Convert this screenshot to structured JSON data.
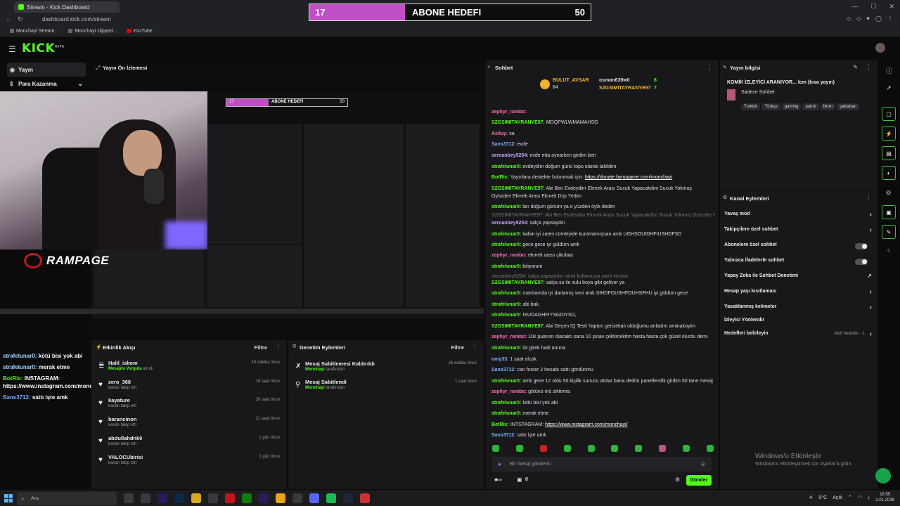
{
  "browser": {
    "tab_title": "Stream - Kick Dashboard",
    "url": "dashboard.kick.com/stream",
    "bookmarks": [
      "Monchayi Stream...",
      "Monchayi clipped...",
      "YouTube"
    ]
  },
  "sub_goal_overlay": {
    "current": "17",
    "label": "ABONE HEDEFI",
    "target": "50",
    "progress": 0.34
  },
  "brand": {
    "logo": "KICK",
    "beta": "BETA",
    "accent": "#53fc18"
  },
  "sidebar": {
    "items": [
      {
        "label": "Yayın",
        "icon": "broadcast-icon"
      },
      {
        "label": "Para Kazanma",
        "icon": "money-icon"
      }
    ]
  },
  "preview": {
    "title": "Yayın Ön İzlemesi",
    "watermark": "RAMPAGE",
    "mini_chat": [
      {
        "user": "strafelunar0:",
        "text": "kötü bisi yok abi"
      },
      {
        "user": "strafelunar0:",
        "text": "merak etme"
      },
      {
        "user": "BotRix:",
        "text": "INSTAGRAM:"
      },
      {
        "user": "",
        "text": "https://www.instagram.com/monchayi/"
      },
      {
        "user": "Sans3712:",
        "text": "sattı işte amk"
      }
    ]
  },
  "activity": {
    "title": "Etkinlik Akışı",
    "filter": "Filtre",
    "items": [
      {
        "name": "Halil_iskom",
        "action": "Mesajını Vurgula",
        "action_suffix": "alındı",
        "time": "15 dakika önce"
      },
      {
        "name": "zero_368",
        "action": "kanalı takip etti",
        "time": "19 saat önce"
      },
      {
        "name": "kayature",
        "action": "kanalı takip etti",
        "time": "20 saat önce"
      },
      {
        "name": "barancinon",
        "action": "kanalı takip etti",
        "time": "21 saat önce"
      },
      {
        "name": "abdullahdnk0",
        "action": "kanalı takip etti",
        "time": "1 gün önce"
      },
      {
        "name": "VALOCUbirisi",
        "action": "kanalı takip etti",
        "time": "1 gün önce"
      }
    ]
  },
  "moderation": {
    "title": "Denetim Eylemleri",
    "filter": "Filtre",
    "items": [
      {
        "title": "Mesaj Sabitlemesi Kaldırıldı",
        "by": "Monchayi",
        "suffix": "tarafından",
        "time": "26 dakika önce"
      },
      {
        "title": "Mesaj Sabitlendi",
        "by": "Monchayi",
        "suffix": "tarafından",
        "time": "1 saat önce"
      }
    ]
  },
  "chat": {
    "title": "Sohbet",
    "leaders": [
      {
        "name": "BULUT_AVSAR",
        "value": "64"
      },
      {
        "name": "osman639w0",
        "value": "8"
      },
      {
        "name": "S2GSIMITAYRANYE97",
        "value": "7"
      }
    ],
    "messages": [
      {
        "user": "zephyr_rambo:",
        "text": "",
        "color": "#ff6fb5"
      },
      {
        "user": "S2GSIMITAYRANYE97:",
        "text": "MDQPWLWMAMAHSG",
        "color": "#53fc18"
      },
      {
        "user": "Asiluy:",
        "text": "sa",
        "color": "#ff6fb5"
      },
      {
        "user": "Sans3712:",
        "text": "evde",
        "color": "#7ab3ff"
      },
      {
        "user": "sercanbey5254:",
        "text": "evde mta oynarken girdim ben",
        "color": "#c7a6ff"
      },
      {
        "user": "strafelunar0:",
        "text": "evdeydim doğum günü topu olarak takildim",
        "color": "#53fc18"
      },
      {
        "user": "BotRix:",
        "text": "Yayınlara destekte bulunmak için:",
        "link": "https://donate.bynogame.com/monchayi",
        "color": "#53fc18"
      },
      {
        "user": "S2GSIMITAYRANYE97:",
        "text": "Abi Ben Evdeydim Ekmek Arası Sucuk Yapacakdim Sucuk Yokmuş",
        "color": "#53fc18"
      },
      {
        "user": "",
        "text": "Oyüzden Ekmek Arası Ekmek Dışı Yedim",
        "color": "#ddd"
      },
      {
        "user": "strafelunar0:",
        "text": "lan doğum günüm ya o yüzden öyle dedim",
        "color": "#53fc18"
      },
      {
        "user": "",
        "text": "S2GSIMITAYRANYE97: Abi Ben Evdeydim Ekmek Arası Sucuk Yapacakdim Sucuk Yokmuş Oyüzden Ekm...",
        "color": "#777"
      },
      {
        "user": "sercanbey5254:",
        "text": "salça yapsaydın",
        "color": "#c7a6ff"
      },
      {
        "user": "strafelunar0:",
        "text": "kafan iyi zaten cümleyide kuramamışsan amk UGHSOUIDHFIUSHDFSD",
        "color": "#53fc18"
      },
      {
        "user": "strafelunar0:",
        "text": "gece gece iyi güldüm amk",
        "color": "#53fc18"
      },
      {
        "user": "zephyr_rambo:",
        "text": "ekmek arası çikolata",
        "color": "#ff6fb5"
      },
      {
        "user": "strafelunar0:",
        "text": "biliyorum",
        "color": "#53fc18"
      },
      {
        "user": "",
        "text": "sercanbey5254: salça yapsaydın isimli kullanıcıya yanıt veriyor",
        "color": "#777"
      },
      {
        "user": "S2GSIMITAYRANYE97:",
        "text": "salça su ile sulu boya gibi geliyor ya",
        "color": "#53fc18"
      },
      {
        "user": "strafelunar0:",
        "text": "manitamda iyi dartamış seni amk SIHDFOUSHFOUHSFHU iyi güldüm gece",
        "color": "#53fc18"
      },
      {
        "user": "strafelunar0:",
        "text": "abi bak.",
        "color": "#53fc18"
      },
      {
        "user": "strafelunar0:",
        "text": "ISUDAGHFIYSGDIYSD,",
        "color": "#53fc18"
      },
      {
        "user": "S2GSIMITAYRANYE97:",
        "text": "Abi Geçen IQ Testi Yaptım gerizekalı olduğumu anladım aminakoyim",
        "color": "#53fc18"
      },
      {
        "user": "zephyr_rambo:",
        "text": "10k puanım olacaktı sana 10 şınav çektircektim hasta hasta çok güzel olurdu demi",
        "color": "#ff6fb5"
      },
      {
        "user": "strafelunar0:",
        "text": "lol girek hadi amına",
        "color": "#53fc18"
      },
      {
        "user": "omy33:",
        "text": "1 saat olcak",
        "color": "#7ab3ff"
      },
      {
        "user": "Sans3712:",
        "text": "can foster 2 hesabı sattı gördünmü",
        "color": "#7ab3ff"
      },
      {
        "user": "strafelunar0:",
        "text": "amk gece 12 oldu 50 kişilik sunucu attılar bana dedim panellendik girdim 50 tane mesaj",
        "color": "#53fc18"
      },
      {
        "user": "zephyr_rambo:",
        "text": "götünü mü siktirmis",
        "color": "#ff6fb5"
      },
      {
        "user": "strafelunar0:",
        "text": "kötü bisi yok abi",
        "color": "#53fc18"
      },
      {
        "user": "strafelunar0:",
        "text": "merak etme",
        "color": "#53fc18"
      },
      {
        "user": "BotRix:",
        "text": "INTSTAGRAM:",
        "link": "https://www.instagram.com/monchayi/",
        "color": "#53fc18"
      },
      {
        "user": "Sans3712:",
        "text": "sattı işte amk",
        "color": "#7ab3ff"
      }
    ],
    "input_placeholder": "Bir mesaj gönderin",
    "send_label": "Gönder",
    "points": "0"
  },
  "stream_info": {
    "title": "Yayın bilgisi",
    "stream_title": "KOMİK İZLEYİCİ ARANIYOR... lcm (kısa yayın)",
    "category": "Sadece Sohbet",
    "tags": [
      "Turkish",
      "Türkçe",
      "gaming",
      "patırtı",
      "bkırtı",
      "şaklaban"
    ]
  },
  "channel_actions": {
    "title": "Kanal Eylemleri",
    "items": [
      {
        "label": "Yavaş mod",
        "control": "chevron"
      },
      {
        "label": "Takipçilere özel sohbet",
        "control": "chevron"
      },
      {
        "label": "Abonelere özel sohbet",
        "control": "toggle"
      },
      {
        "label": "Yalnızca ifadelerle sohbet",
        "control": "toggle"
      },
      {
        "label": "Yapay Zeka ile Sohbet Denetimi",
        "control": "external"
      },
      {
        "label": "Hesap yaşı kısıtlaması",
        "control": "chevron"
      },
      {
        "label": "Yasaklanmış kelimeler",
        "control": "chevron"
      },
      {
        "label": "İzleyici Yönlendir",
        "control": "none"
      },
      {
        "label": "Hedefleri belirleyin",
        "control": "chevron",
        "extra": "Aktif hedefler - 1"
      }
    ]
  },
  "windows_activation": {
    "title": "Windows'u Etkinleştir",
    "subtitle": "Windows'u etkinleştirmek için Ayarlar'a gidin."
  },
  "taskbar": {
    "search_placeholder": "Ara",
    "weather": "0°C",
    "weather_text": "Açık",
    "time": "18:55",
    "date": "2.01.2026"
  }
}
